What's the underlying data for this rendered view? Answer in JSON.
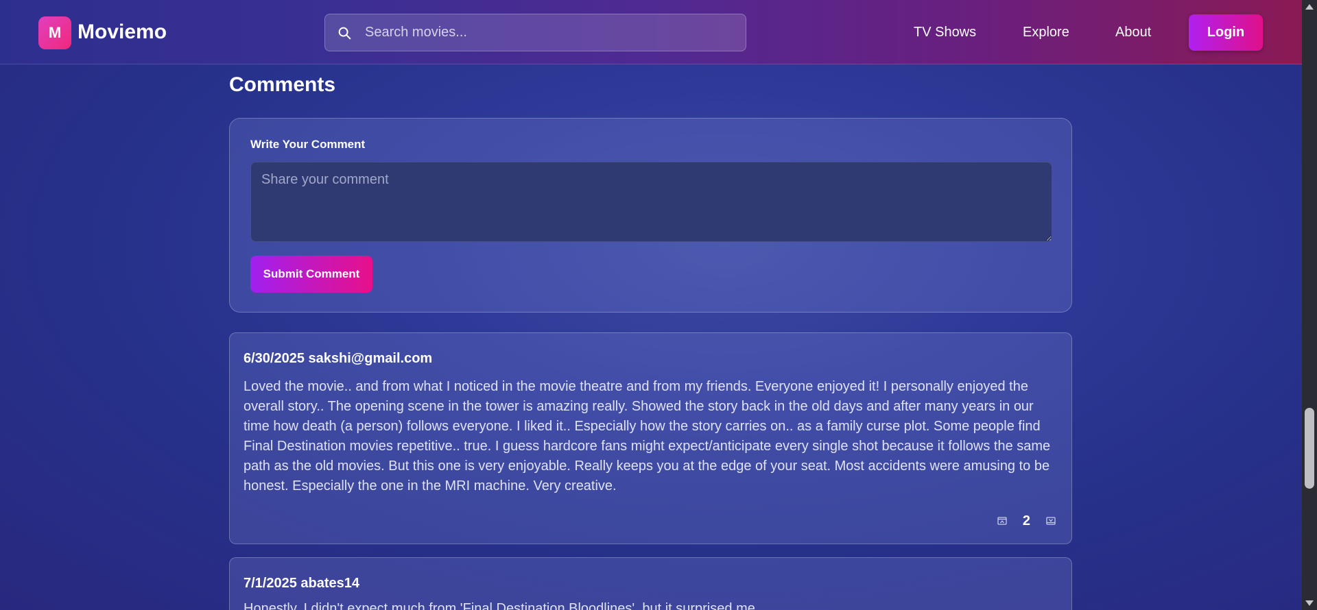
{
  "header": {
    "logo_letter": "M",
    "brand": "Moviemo",
    "search_placeholder": "Search movies...",
    "nav": [
      "TV Shows",
      "Explore",
      "About"
    ],
    "login_label": "Login"
  },
  "comments_section": {
    "title": "Comments",
    "form": {
      "label": "Write Your Comment",
      "placeholder": "Share your comment",
      "submit_label": "Submit Comment"
    },
    "comments": [
      {
        "meta": "6/30/2025 sakshi@gmail.com",
        "body": "Loved the movie.. and from what I noticed in the movie theatre and from my friends. Everyone enjoyed it! I personally enjoyed the overall story.. The opening scene in the tower is amazing really. Showed the story back in the old days and after many years in our time how death (a person) follows everyone. I liked it.. Especially how the story carries on.. as a family curse plot. Some people find Final Destination movies repetitive.. true. I guess hardcore fans might expect/anticipate every single shot because it follows the same path as the old movies. But this one is very enjoyable. Really keeps you at the edge of your seat. Most accidents were amusing to be honest. Especially the one in the MRI machine. Very creative.",
        "votes": "2"
      },
      {
        "meta": "7/1/2025 abates14",
        "body": "Honestly, I didn't expect much from 'Final Destination Bloodlines', but it surprised me..."
      }
    ]
  },
  "colors": {
    "accent_gradient_start": "#a020f0",
    "accent_gradient_end": "#e8108a",
    "background": "#2e3a98"
  }
}
